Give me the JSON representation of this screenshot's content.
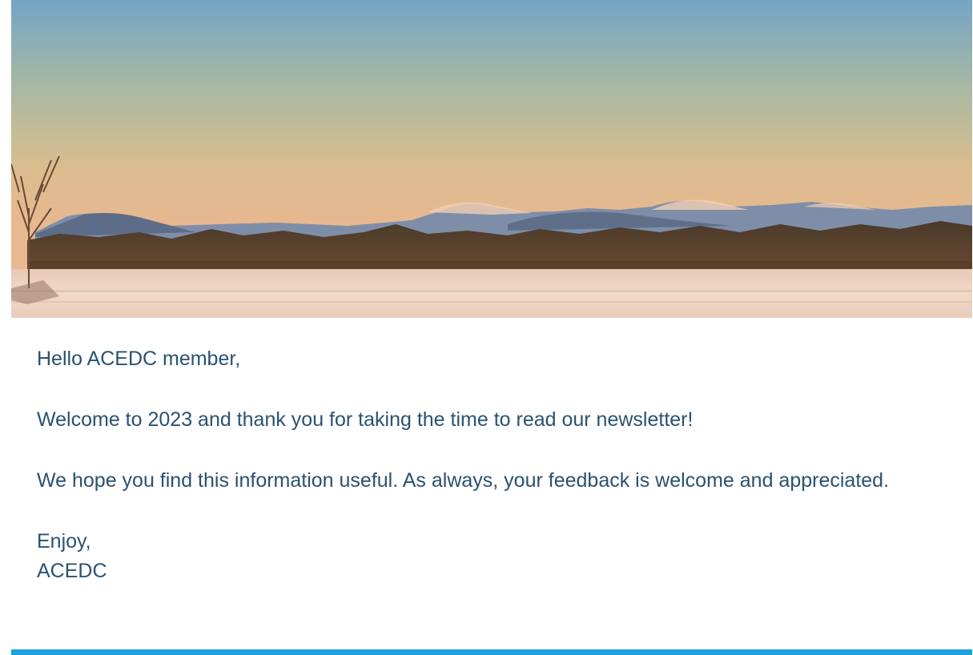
{
  "hero": {
    "icon": "winter-landscape-image"
  },
  "message": {
    "greeting": "Hello ACEDC member,",
    "welcome": "Welcome to 2023 and thank you for taking the time to read our newsletter!",
    "hope": "We hope you find this information useful. As always, your feedback is welcome and appreciated.",
    "signoff": "Enjoy,",
    "signature": "ACEDC"
  },
  "colors": {
    "text": "#2a5270",
    "accent_bar": "#1aa3dc",
    "background": "#ffffff"
  }
}
